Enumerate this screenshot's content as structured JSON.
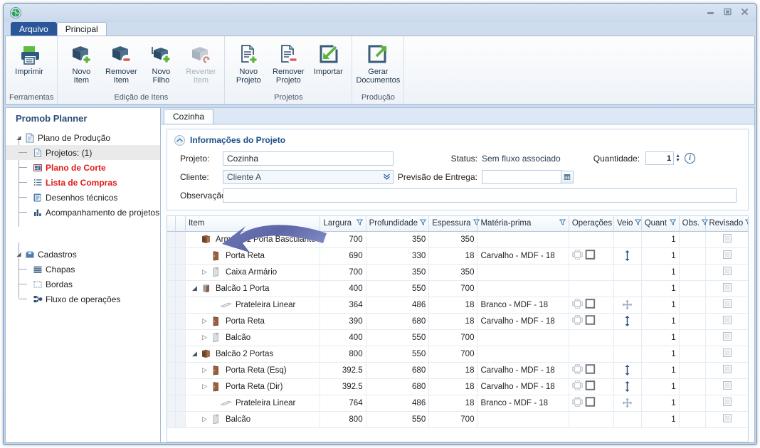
{
  "window": {
    "logo_icon": "globe-icon",
    "controls": [
      {
        "name": "minimize-button",
        "icon": "minimize-icon"
      },
      {
        "name": "maximize-button",
        "icon": "maximize-icon"
      },
      {
        "name": "close-button",
        "icon": "close-icon"
      }
    ]
  },
  "ribbon": {
    "tabs": [
      {
        "label": "Arquivo",
        "type": "file"
      },
      {
        "label": "Principal",
        "type": "active"
      }
    ],
    "groups": [
      {
        "label": "Ferramentas",
        "buttons": [
          {
            "label": "Imprimir",
            "icon": "printer-icon",
            "disabled": false
          }
        ]
      },
      {
        "label": "Edição de Itens",
        "buttons": [
          {
            "label": "Novo\nItem",
            "icon": "box-add-icon",
            "disabled": false
          },
          {
            "label": "Remover\nItem",
            "icon": "box-remove-icon",
            "disabled": false
          },
          {
            "label": "Novo\nFilho",
            "icon": "box-child-add-icon",
            "disabled": false
          },
          {
            "label": "Reverter\nItem",
            "icon": "box-undo-icon",
            "disabled": true
          }
        ]
      },
      {
        "label": "Projetos",
        "buttons": [
          {
            "label": "Novo\nProjeto",
            "icon": "document-add-icon",
            "disabled": false
          },
          {
            "label": "Remover\nProjeto",
            "icon": "document-remove-icon",
            "disabled": false
          },
          {
            "label": "Importar",
            "icon": "import-arrow-icon",
            "disabled": false
          }
        ]
      },
      {
        "label": "Produção",
        "buttons": [
          {
            "label": "Gerar\nDocumentos",
            "icon": "export-arrow-icon",
            "disabled": false
          }
        ]
      }
    ]
  },
  "sidebar": {
    "title": "Promob Planner",
    "items": [
      {
        "label": "Plano de Produção",
        "icon": "plan-icon",
        "level": 0,
        "expander": "expanded",
        "state": "normal",
        "name": "sidebar-item-plano-de-producao"
      },
      {
        "label": "Projetos: (1)",
        "icon": "document-icon",
        "level": 1,
        "expander": "none",
        "state": "selected",
        "name": "sidebar-item-projetos"
      },
      {
        "label": "Plano de Corte",
        "icon": "cutting-plan-icon",
        "level": 1,
        "expander": "none",
        "state": "red",
        "name": "sidebar-item-plano-de-corte"
      },
      {
        "label": "Lista de Compras",
        "icon": "list-icon",
        "level": 1,
        "expander": "none",
        "state": "red",
        "name": "sidebar-item-lista-de-compras"
      },
      {
        "label": "Desenhos técnicos",
        "icon": "blueprint-icon",
        "level": 1,
        "expander": "none",
        "state": "normal",
        "name": "sidebar-item-desenhos-tecnicos"
      },
      {
        "label": "Acompanhamento de projetos",
        "icon": "bar-chart-icon",
        "level": 1,
        "expander": "none",
        "state": "normal",
        "name": "sidebar-item-acompanhamento"
      },
      {
        "label": "Cadastros",
        "icon": "folder-box-icon",
        "level": 0,
        "expander": "expanded",
        "state": "normal",
        "name": "sidebar-item-cadastros"
      },
      {
        "label": "Chapas",
        "icon": "sheets-icon",
        "level": 1,
        "expander": "none",
        "state": "normal",
        "name": "sidebar-item-chapas"
      },
      {
        "label": "Bordas",
        "icon": "edges-icon",
        "level": 1,
        "expander": "none",
        "state": "normal",
        "name": "sidebar-item-bordas"
      },
      {
        "label": "Fluxo de operações",
        "icon": "flow-icon",
        "level": 1,
        "expander": "none",
        "state": "normal",
        "name": "sidebar-item-fluxo-de-operacoes"
      }
    ]
  },
  "doc_tabs": [
    {
      "label": "Cozinha",
      "active": true
    }
  ],
  "info_panel": {
    "title": "Informações do Projeto",
    "collapse_icon": "chevron-up-icon",
    "fields": {
      "projeto_label": "Projeto:",
      "projeto_value": "Cozinha",
      "cliente_label": "Cliente:",
      "cliente_value": "Cliente A",
      "observacao_label": "Observação:",
      "observacao_value": "",
      "status_label": "Status:",
      "status_value": "Sem fluxo associado",
      "previsao_label": "Previsão de Entrega:",
      "previsao_value": "",
      "quantidade_label": "Quantidade:",
      "quantidade_value": "1",
      "calendar_icon": "calendar-icon",
      "info_icon": "info-icon"
    }
  },
  "grid": {
    "columns": [
      {
        "label": "Item",
        "filter": false,
        "align": "left"
      },
      {
        "label": "Largura",
        "filter": true,
        "align": "right"
      },
      {
        "label": "Profundidade",
        "filter": true,
        "align": "right"
      },
      {
        "label": "Espessura",
        "filter": true,
        "align": "right"
      },
      {
        "label": "Matéria-prima",
        "filter": true,
        "align": "left"
      },
      {
        "label": "Operações",
        "filter": false,
        "align": "left"
      },
      {
        "label": "Veio",
        "filter": true,
        "align": "center"
      },
      {
        "label": "Quant",
        "filter": true,
        "align": "right"
      },
      {
        "label": "Obs.",
        "filter": true,
        "align": "center"
      },
      {
        "label": "Revisado",
        "filter": true,
        "align": "center"
      }
    ],
    "rows": [
      {
        "item": "Armário 1 Porta Basculante",
        "icon": "cabinet-icon",
        "indent": 1,
        "expander": "none",
        "largura": "700",
        "profundidade": "350",
        "espessura": "350",
        "espessura_thin": false,
        "materia": "",
        "operacoes": [],
        "veio": "none",
        "quant": "1",
        "obs": "",
        "revisado": "checkbox"
      },
      {
        "item": "Porta Reta",
        "icon": "door-icon",
        "indent": 2,
        "expander": "none",
        "largura": "690",
        "profundidade": "330",
        "espessura": "18",
        "espessura_thin": true,
        "materia": "Carvalho - MDF - 18",
        "operacoes": [
          "edge-band-icon",
          "square-panel-icon"
        ],
        "veio": "vertical",
        "quant": "1",
        "obs": "",
        "revisado": "checkbox"
      },
      {
        "item": "Caixa Armário",
        "icon": "box-panel-icon",
        "indent": 2,
        "expander": "collapsed",
        "largura": "700",
        "profundidade": "350",
        "espessura": "350",
        "espessura_thin": false,
        "materia": "",
        "operacoes": [],
        "veio": "none",
        "quant": "1",
        "obs": "",
        "revisado": "checkbox"
      },
      {
        "item": "Balcão 1 Porta",
        "icon": "cabinet-gray-icon",
        "indent": 1,
        "expander": "expanded",
        "largura": "400",
        "profundidade": "550",
        "espessura": "700",
        "espessura_thin": false,
        "materia": "",
        "operacoes": [],
        "veio": "none",
        "quant": "1",
        "obs": "",
        "revisado": "checkbox"
      },
      {
        "item": "Prateleira Linear",
        "icon": "shelf-icon",
        "indent": 3,
        "expander": "none",
        "largura": "364",
        "profundidade": "486",
        "espessura": "18",
        "espessura_thin": true,
        "materia": "Branco - MDF - 18",
        "operacoes": [
          "edge-band-icon",
          "square-panel-icon"
        ],
        "veio": "free",
        "quant": "1",
        "obs": "",
        "revisado": "checkbox"
      },
      {
        "item": "Porta Reta",
        "icon": "door-icon",
        "indent": 2,
        "expander": "collapsed",
        "largura": "390",
        "profundidade": "680",
        "espessura": "18",
        "espessura_thin": true,
        "materia": "Carvalho - MDF - 18",
        "operacoes": [
          "edge-band-icon",
          "square-panel-icon"
        ],
        "veio": "vertical",
        "quant": "1",
        "obs": "",
        "revisado": "checkbox"
      },
      {
        "item": "Balcão",
        "icon": "box-panel-icon",
        "indent": 2,
        "expander": "collapsed",
        "largura": "400",
        "profundidade": "550",
        "espessura": "700",
        "espessura_thin": false,
        "materia": "",
        "operacoes": [],
        "veio": "none",
        "quant": "1",
        "obs": "",
        "revisado": "checkbox"
      },
      {
        "item": "Balcão 2 Portas",
        "icon": "cabinet-icon",
        "indent": 1,
        "expander": "expanded",
        "largura": "800",
        "profundidade": "550",
        "espessura": "700",
        "espessura_thin": false,
        "materia": "",
        "operacoes": [],
        "veio": "none",
        "quant": "1",
        "obs": "",
        "revisado": "checkbox"
      },
      {
        "item": "Porta Reta (Esq)",
        "icon": "door-icon",
        "indent": 2,
        "expander": "collapsed",
        "largura": "392.5",
        "profundidade": "680",
        "espessura": "18",
        "espessura_thin": true,
        "materia": "Carvalho - MDF - 18",
        "operacoes": [
          "edge-band-icon",
          "square-panel-icon"
        ],
        "veio": "vertical",
        "quant": "1",
        "obs": "",
        "revisado": "checkbox"
      },
      {
        "item": "Porta Reta (Dir)",
        "icon": "door-icon",
        "indent": 2,
        "expander": "collapsed",
        "largura": "392.5",
        "profundidade": "680",
        "espessura": "18",
        "espessura_thin": true,
        "materia": "Carvalho - MDF - 18",
        "operacoes": [
          "edge-band-icon",
          "square-panel-icon"
        ],
        "veio": "vertical",
        "quant": "1",
        "obs": "",
        "revisado": "checkbox"
      },
      {
        "item": "Prateleira Linear",
        "icon": "shelf-icon",
        "indent": 3,
        "expander": "none",
        "largura": "764",
        "profundidade": "486",
        "espessura": "18",
        "espessura_thin": true,
        "materia": "Branco - MDF - 18",
        "operacoes": [
          "edge-band-icon",
          "square-panel-icon"
        ],
        "veio": "free",
        "quant": "1",
        "obs": "",
        "revisado": "checkbox"
      },
      {
        "item": "Balcão",
        "icon": "box-panel-icon",
        "indent": 2,
        "expander": "collapsed",
        "largura": "800",
        "profundidade": "550",
        "espessura": "700",
        "espessura_thin": false,
        "materia": "",
        "operacoes": [],
        "veio": "none",
        "quant": "1",
        "obs": "",
        "revisado": "checkbox"
      }
    ]
  },
  "annotation": {
    "arrow_icon": "curved-arrow-annotation",
    "color": "#5a63a5"
  },
  "colors": {
    "accent": "#2b579a",
    "red_highlight": "#e01b1b",
    "header_blue": "#1a4f86",
    "window_border": "#6f93bf"
  }
}
